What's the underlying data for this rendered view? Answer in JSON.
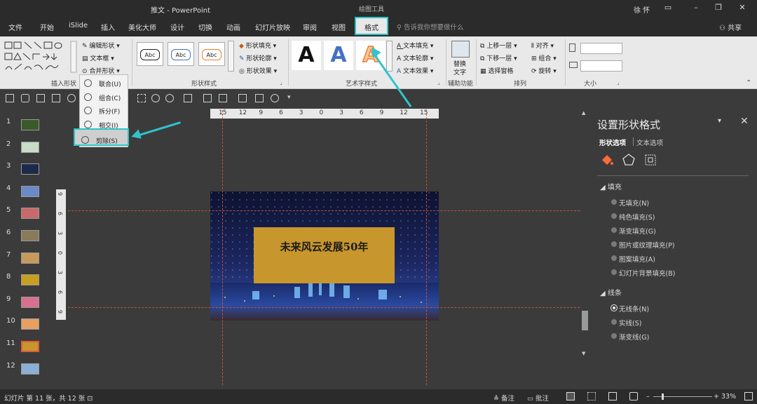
{
  "window": {
    "title": "推文  -  PowerPoint",
    "contextual_tab_group": "绘图工具",
    "user": "徐 怀",
    "controls": [
      "▭",
      "–",
      "❐",
      "✕"
    ]
  },
  "tabs": [
    {
      "label": "文件"
    },
    {
      "label": "开始"
    },
    {
      "label": "iSlide"
    },
    {
      "label": "插入"
    },
    {
      "label": "美化大师"
    },
    {
      "label": "设计"
    },
    {
      "label": "切换"
    },
    {
      "label": "动画"
    },
    {
      "label": "幻灯片放映"
    },
    {
      "label": "审阅"
    },
    {
      "label": "视图"
    }
  ],
  "active_tab": "格式",
  "tell_me": "告诉我你想要做什么",
  "share": "共享",
  "ribbon": {
    "insert_shapes": {
      "label": "插入形状",
      "edit_shape": "编辑形状",
      "text_box": "文本框",
      "merge_shapes": "合并形状"
    },
    "shape_styles": {
      "label": "形状样式",
      "samples": [
        "Abc",
        "Abc",
        "Abc"
      ],
      "fill": "形状填充",
      "outline": "形状轮廓",
      "effects": "形状效果"
    },
    "wordart": {
      "label": "艺术字样式",
      "samples": [
        "A",
        "A",
        "A"
      ],
      "text_fill": "文本填充",
      "text_outline": "文本轮廓",
      "text_effects": "文本效果"
    },
    "accessibility": {
      "label": "辅助功能",
      "alt_text_line1": "替换",
      "alt_text_line2": "文字"
    },
    "arrange": {
      "label": "排列",
      "bring_forward": "上移一层",
      "send_backward": "下移一层",
      "selection_pane": "选择窗格",
      "align": "对齐",
      "group": "组合",
      "rotate": "旋转"
    },
    "size": {
      "label": "大小"
    }
  },
  "merge_menu": [
    {
      "label": "联合(U)"
    },
    {
      "label": "组合(C)"
    },
    {
      "label": "拆分(F)"
    },
    {
      "label": "相交(I)"
    },
    {
      "label": "剪除(S)"
    }
  ],
  "ruler": {
    "top_ticks": [
      "15",
      "12",
      "9",
      "6",
      "3",
      "0",
      "3",
      "6",
      "9",
      "12",
      "15"
    ],
    "left_ticks": [
      "9",
      "6",
      "3",
      "0",
      "3",
      "6",
      "9"
    ]
  },
  "slides": [
    {
      "num": "1",
      "color": "#3a5a2a"
    },
    {
      "num": "2",
      "color": "#c8dcc8"
    },
    {
      "num": "3",
      "color": "#1c2a4a"
    },
    {
      "num": "4",
      "color": "#6a8ac8"
    },
    {
      "num": "5",
      "color": "#c86a6a"
    },
    {
      "num": "6",
      "color": "#8a7a5a"
    },
    {
      "num": "7",
      "color": "#c89a5a"
    },
    {
      "num": "8",
      "color": "#c8a020"
    },
    {
      "num": "9",
      "color": "#d87090"
    },
    {
      "num": "10",
      "color": "#e8a060"
    },
    {
      "num": "11",
      "color": "#c7962c"
    },
    {
      "num": "12",
      "color": "#8ab0d8"
    }
  ],
  "current_slide_title": "未来风云发展50年",
  "format_pane": {
    "title": "设置形状格式",
    "tab_shape_options": "形状选项",
    "tab_text_options": "文本选项",
    "fill_section": "填充",
    "fill_options": [
      {
        "label": "无填充(N)"
      },
      {
        "label": "纯色填充(S)"
      },
      {
        "label": "渐变填充(G)"
      },
      {
        "label": "图片或纹理填充(P)"
      },
      {
        "label": "图案填充(A)"
      },
      {
        "label": "幻灯片背景填充(B)"
      }
    ],
    "line_section": "线条",
    "line_options": [
      {
        "label": "无线条(N)"
      },
      {
        "label": "实线(S)"
      },
      {
        "label": "渐变线(G)"
      }
    ]
  },
  "status": {
    "slide_info": "幻灯片 第 11 张，共 12 张",
    "notes": "备注",
    "comments": "批注",
    "zoom": "33%"
  }
}
